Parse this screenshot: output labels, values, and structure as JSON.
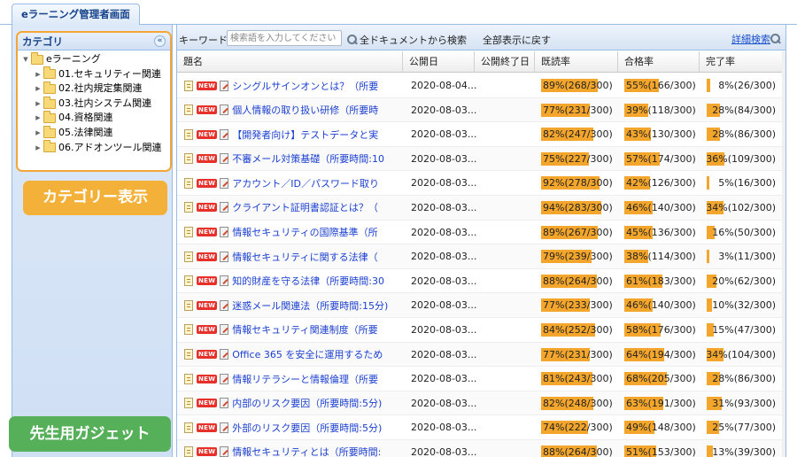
{
  "tab": {
    "title": "eラーニング管理者画面"
  },
  "category_panel": {
    "header": "カテゴリ",
    "collapse_icon": "«",
    "root": "eラーニング",
    "children": [
      "01.セキュリティー関連",
      "02.社内規定集関連",
      "03.社内システム関連",
      "04.資格関連",
      "05.法律関連",
      "06.アドオンツール関連"
    ]
  },
  "badges": {
    "category_display": "カテゴリー表示",
    "teacher_gadget": "先生用ガジェット"
  },
  "toolbar": {
    "keyword_label": "キーワード:",
    "keyword_placeholder": "検索語を入力してください",
    "search_all": "全ドキュメントから検索",
    "show_all": "全部表示に戻す",
    "advanced_search": "詳細検索"
  },
  "columns": {
    "title": "題名",
    "published": "公開日",
    "end": "公開終了日",
    "read_rate": "既読率",
    "pass_rate": "合格率",
    "completion_rate": "完了率"
  },
  "new_label": "NEW",
  "rows": [
    {
      "title": "シングルサインオンとは？（所要",
      "date": "2020-08-04...",
      "read": "89%(268/300)",
      "read_pct": 89,
      "pass": "55%(166/300)",
      "pass_pct": 55,
      "comp": "8%(26/300)",
      "comp_pct": 8
    },
    {
      "title": "個人情報の取り扱い研修（所要時",
      "date": "2020-08-03...",
      "read": "77%(231/300)",
      "read_pct": 77,
      "pass": "39%(118/300)",
      "pass_pct": 39,
      "comp": "28%(84/300)",
      "comp_pct": 28
    },
    {
      "title": "【開発者向け】テストデータと実",
      "date": "2020-08-03...",
      "read": "82%(247/300)",
      "read_pct": 82,
      "pass": "43%(130/300)",
      "pass_pct": 43,
      "comp": "28%(86/300)",
      "comp_pct": 28
    },
    {
      "title": "不審メール対策基礎（所要時間:10",
      "date": "2020-08-03...",
      "read": "75%(227/300)",
      "read_pct": 75,
      "pass": "57%(174/300)",
      "pass_pct": 57,
      "comp": "36%(109/300)",
      "comp_pct": 36
    },
    {
      "title": "アカウント／ID／パスワード取り",
      "date": "2020-08-03...",
      "read": "92%(278/300)",
      "read_pct": 92,
      "pass": "42%(126/300)",
      "pass_pct": 42,
      "comp": "5%(16/300)",
      "comp_pct": 5
    },
    {
      "title": "クライアント証明書認証とは？（",
      "date": "2020-08-03...",
      "read": "94%(283/300)",
      "read_pct": 94,
      "pass": "46%(140/300)",
      "pass_pct": 46,
      "comp": "34%(102/300)",
      "comp_pct": 34
    },
    {
      "title": "情報セキュリティの国際基準（所",
      "date": "2020-08-03...",
      "read": "89%(267/300)",
      "read_pct": 89,
      "pass": "45%(136/300)",
      "pass_pct": 45,
      "comp": "16%(50/300)",
      "comp_pct": 16
    },
    {
      "title": "情報セキュリティに関する法律（",
      "date": "2020-08-03...",
      "read": "79%(239/300)",
      "read_pct": 79,
      "pass": "38%(114/300)",
      "pass_pct": 38,
      "comp": "3%(11/300)",
      "comp_pct": 3
    },
    {
      "title": "知的財産を守る法律（所要時間:30",
      "date": "2020-08-03...",
      "read": "88%(264/300)",
      "read_pct": 88,
      "pass": "61%(183/300)",
      "pass_pct": 61,
      "comp": "20%(62/300)",
      "comp_pct": 20
    },
    {
      "title": "迷惑メール関連法（所要時間:15分)",
      "date": "2020-08-03...",
      "read": "77%(233/300)",
      "read_pct": 77,
      "pass": "46%(140/300)",
      "pass_pct": 46,
      "comp": "10%(32/300)",
      "comp_pct": 10
    },
    {
      "title": "情報セキュリティ関連制度（所要",
      "date": "2020-08-03...",
      "read": "84%(252/300)",
      "read_pct": 84,
      "pass": "58%(176/300)",
      "pass_pct": 58,
      "comp": "15%(47/300)",
      "comp_pct": 15
    },
    {
      "title": "Office 365 を安全に運用するため",
      "date": "2020-08-03...",
      "read": "77%(231/300)",
      "read_pct": 77,
      "pass": "64%(194/300)",
      "pass_pct": 64,
      "comp": "34%(104/300)",
      "comp_pct": 34
    },
    {
      "title": "情報リテラシーと情報倫理（所要",
      "date": "2020-08-03...",
      "read": "81%(243/300)",
      "read_pct": 81,
      "pass": "68%(205/300)",
      "pass_pct": 68,
      "comp": "28%(86/300)",
      "comp_pct": 28
    },
    {
      "title": "内部のリスク要因（所要時間:5分)",
      "date": "2020-08-03...",
      "read": "82%(248/300)",
      "read_pct": 82,
      "pass": "63%(191/300)",
      "pass_pct": 63,
      "comp": "31%(93/300)",
      "comp_pct": 31
    },
    {
      "title": "外部のリスク要因（所要時間:5分)",
      "date": "2020-08-03...",
      "read": "74%(222/300)",
      "read_pct": 74,
      "pass": "49%(148/300)",
      "pass_pct": 49,
      "comp": "25%(77/300)",
      "comp_pct": 25
    },
    {
      "title": "情報セキュリティとは（所要時間:",
      "date": "2020-08-03...",
      "read": "88%(264/300)",
      "read_pct": 88,
      "pass": "51%(153/300)",
      "pass_pct": 51,
      "comp": "13%(39/300)",
      "comp_pct": 13
    }
  ],
  "colors": {
    "accent": "#f4a62c",
    "badge_orange": "#f4b13a",
    "badge_green": "#56b05a",
    "link": "#1a3fd0",
    "new": "#e8302a"
  }
}
